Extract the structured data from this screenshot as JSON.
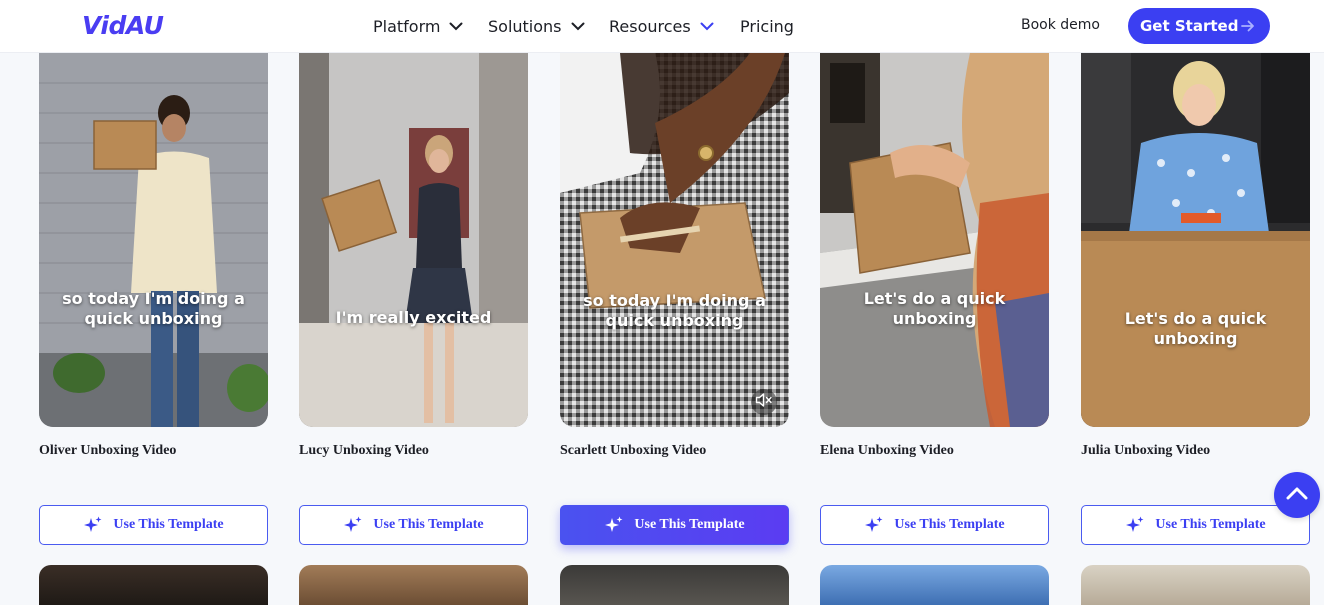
{
  "header": {
    "logo": "VidAU",
    "nav": [
      {
        "label": "Platform",
        "has_dropdown": true,
        "accent": false
      },
      {
        "label": "Solutions",
        "has_dropdown": true,
        "accent": false
      },
      {
        "label": "Resources",
        "has_dropdown": true,
        "accent": true
      },
      {
        "label": "Pricing",
        "has_dropdown": false,
        "accent": false
      }
    ],
    "book_demo": "Book demo",
    "get_started": "Get Started"
  },
  "colors": {
    "brand": "#3b3ff2",
    "background": "#f6f8fb",
    "text": "#1d1f26"
  },
  "cards": [
    {
      "title": "Oliver Unboxing Video",
      "caption": "so today I'm doing a quick unboxing",
      "button": "Use This Template",
      "active": false
    },
    {
      "title": "Lucy Unboxing Video",
      "caption": "I'm really excited",
      "button": "Use This Template",
      "active": false
    },
    {
      "title": "Scarlett Unboxing Video",
      "caption": "so today I'm doing a quick unboxing",
      "button": "Use This Template",
      "active": true,
      "mute_icon": "volume-mute-icon"
    },
    {
      "title": "Elena Unboxing Video",
      "caption": "Let's do a quick unboxing",
      "button": "Use This Template",
      "active": false
    },
    {
      "title": "Julia Unboxing Video",
      "caption": "Let's do a quick unboxing",
      "button": "Use This Template",
      "active": false
    }
  ],
  "icons": {
    "button": "sparkles-icon",
    "scroll": "chevron-up-icon",
    "cta": "arrow-right-icon"
  }
}
